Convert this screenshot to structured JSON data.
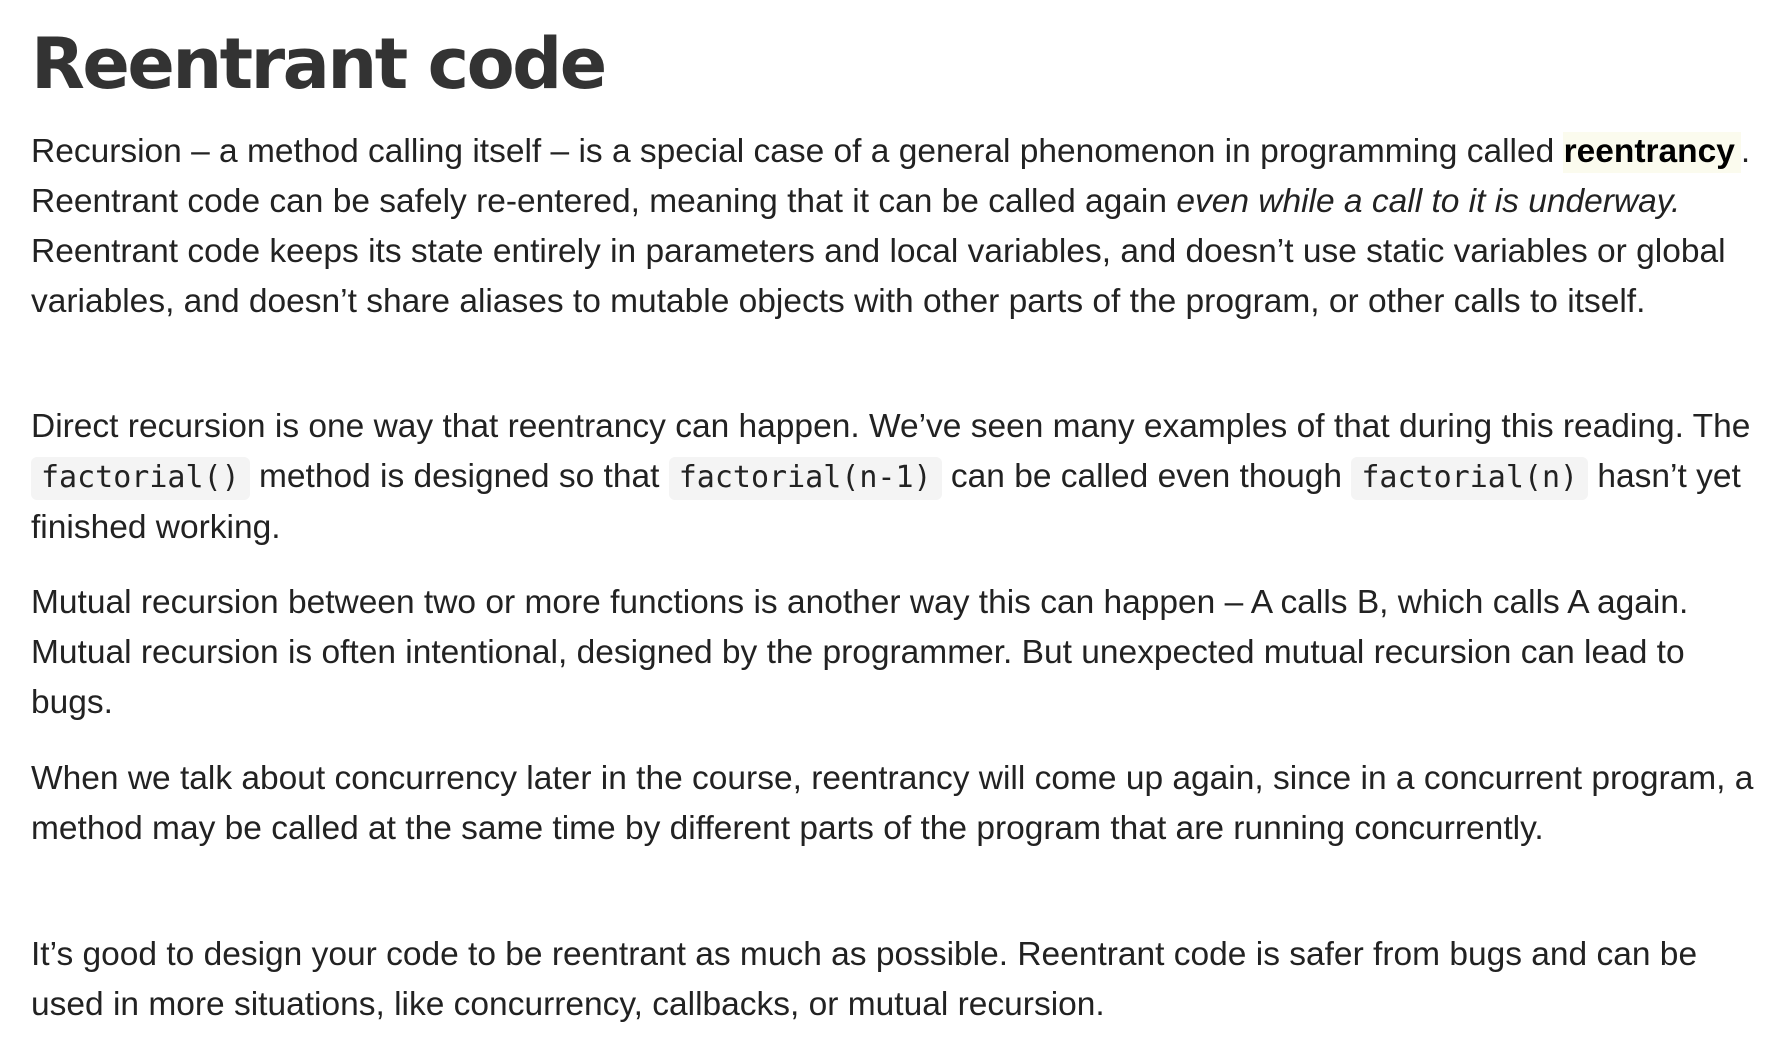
{
  "title": "Reentrant code",
  "p1": {
    "t1": "Recursion – a method calling itself – is a special case of a general phenomenon in programming called ",
    "term": "reentrancy",
    "t2": ". Reentrant code can be safely re-entered, meaning that it can be called again ",
    "em": "even while a call to it is underway.",
    "t3": " Reentrant code keeps its state entirely in parameters and local variables, and doesn’t use static variables or global variables, and doesn’t share aliases to mutable objects with other parts of the program, or other calls to itself."
  },
  "p2": {
    "t1": "Direct recursion is one way that reentrancy can happen. We’ve seen many examples of that during this reading. The ",
    "code1": "factorial()",
    "t2": " method is designed so that ",
    "code2": "factorial(n-1)",
    "t3": " can be called even though ",
    "code3": "factorial(n)",
    "t4": " hasn’t yet finished working."
  },
  "p3": "Mutual recursion between two or more functions is another way this can happen – A calls B, which calls A again. Mutual recursion is often intentional, designed by the programmer. But unexpected mutual recursion can lead to bugs.",
  "p4": "When we talk about concurrency later in the course, reentrancy will come up again, since in a concurrent program, a method may be called at the same time by different parts of the program that are running concurrently.",
  "p5": "It’s good to design your code to be reentrant as much as possible. Reentrant code is safer from bugs and can be used in more situations, like concurrency, callbacks, or mutual recursion."
}
